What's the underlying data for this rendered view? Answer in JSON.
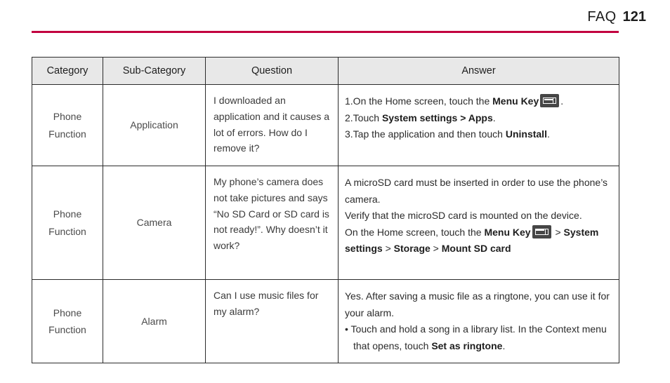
{
  "header": {
    "title": "FAQ",
    "page_number": "121",
    "rule_color": "#c2003f"
  },
  "table": {
    "columns": [
      {
        "key": "category",
        "label": "Category"
      },
      {
        "key": "subcategory",
        "label": "Sub-Category"
      },
      {
        "key": "question",
        "label": "Question"
      },
      {
        "key": "answer",
        "label": "Answer"
      }
    ],
    "header_background": "#e8e8e8",
    "rows": [
      {
        "category_line1": "Phone",
        "category_line2": "Function",
        "subcategory": "Application",
        "question": "I downloaded an application and it causes a lot of errors. How do I remove it?",
        "answer_lines": [
          {
            "segments": [
              {
                "text": "1.On the Home screen, touch the ",
                "bold": false
              },
              {
                "text": "Menu Key",
                "bold": true
              },
              {
                "icon": "menu-key-icon"
              },
              {
                "text": ".",
                "bold": false
              }
            ]
          },
          {
            "segments": [
              {
                "text": "2.Touch ",
                "bold": false
              },
              {
                "text": "System settings > Apps",
                "bold": true
              },
              {
                "text": ".",
                "bold": false
              }
            ]
          },
          {
            "segments": [
              {
                "text": "3.Tap the application and then touch ",
                "bold": false
              },
              {
                "text": "Uninstall",
                "bold": true
              },
              {
                "text": ".",
                "bold": false
              }
            ]
          }
        ]
      },
      {
        "category_line1": "Phone",
        "category_line2": "Function",
        "subcategory": "Camera",
        "question": "My phone’s camera does not take pictures and says “No SD Card or SD card is not ready!”. Why doesn’t it work?",
        "answer_lines": [
          {
            "segments": [
              {
                "text": "A microSD card must be inserted in order to use the phone’s camera.",
                "bold": false
              }
            ]
          },
          {
            "segments": [
              {
                "text": "Verify that the microSD card is mounted on the device.",
                "bold": false
              }
            ]
          },
          {
            "segments": [
              {
                "text": "On the Home screen, touch the ",
                "bold": false
              },
              {
                "text": "Menu Key",
                "bold": true
              },
              {
                "icon": "menu-key-icon"
              },
              {
                "text": " > ",
                "bold": false
              },
              {
                "text": "System settings",
                "bold": true
              },
              {
                "text": " > ",
                "bold": false
              },
              {
                "text": "Storage",
                "bold": true
              },
              {
                "text": " > ",
                "bold": false
              },
              {
                "text": "Mount SD card",
                "bold": true
              }
            ]
          }
        ]
      },
      {
        "category_line1": "Phone",
        "category_line2": "Function",
        "subcategory": "Alarm",
        "question": "Can I use music files for my alarm?",
        "answer_lines": [
          {
            "segments": [
              {
                "text": "Yes. After saving a music file as a ringtone, you can use it for your alarm.",
                "bold": false
              }
            ]
          },
          {
            "hanging": true,
            "segments": [
              {
                "text": "• Touch and hold a song in a library list. In the Context menu that opens, touch ",
                "bold": false
              },
              {
                "text": "Set as ringtone",
                "bold": true
              },
              {
                "text": ".",
                "bold": false
              }
            ]
          }
        ]
      }
    ]
  }
}
